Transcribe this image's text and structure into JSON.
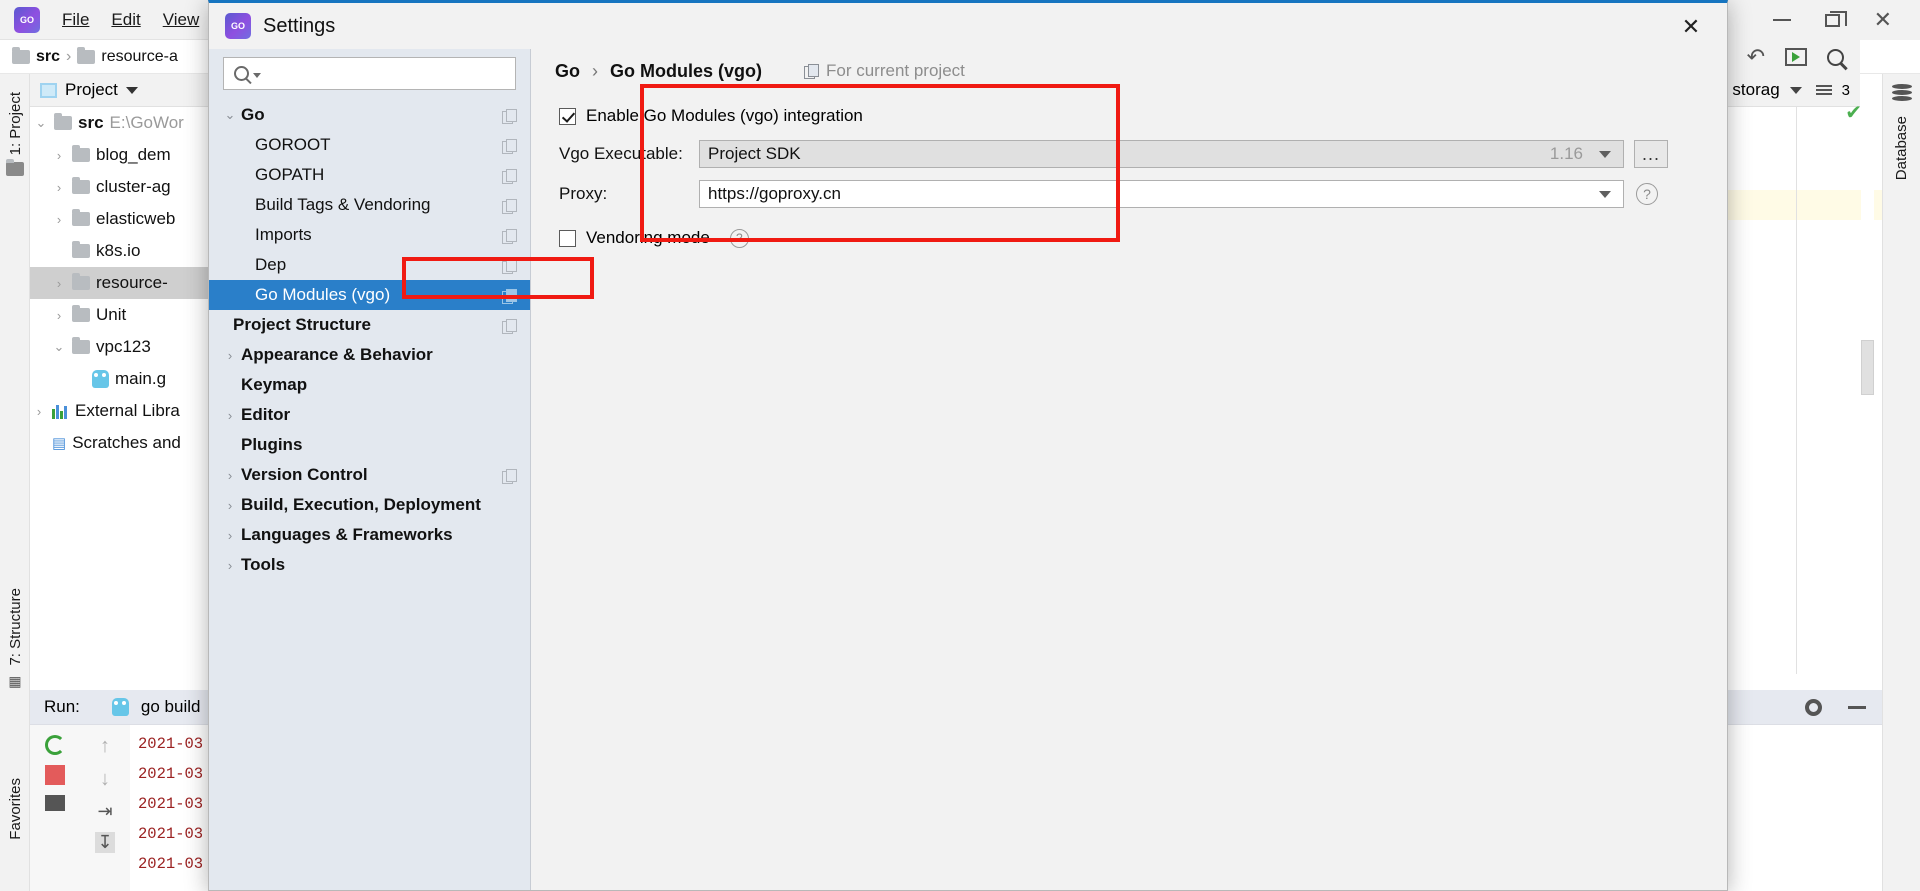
{
  "ide": {
    "menu": [
      "File",
      "Edit",
      "View"
    ],
    "breadcrumb": [
      "src",
      "resource-a"
    ],
    "project_tool_label": "Project",
    "left_strips": {
      "project": "1: Project",
      "structure": "7: Structure",
      "favorites": "Favorites"
    },
    "tree": [
      {
        "label": "src",
        "suffix": "E:\\GoWor",
        "chev": "v",
        "bold": true,
        "indent": 0,
        "icon": "folder-icon"
      },
      {
        "label": "blog_dem",
        "suffix": "",
        "chev": ">",
        "bold": false,
        "indent": 1,
        "icon": "folder-icon"
      },
      {
        "label": "cluster-ag",
        "suffix": "",
        "chev": ">",
        "bold": false,
        "indent": 1,
        "icon": "folder-icon"
      },
      {
        "label": "elasticweb",
        "suffix": "",
        "chev": ">",
        "bold": false,
        "indent": 1,
        "icon": "folder-icon"
      },
      {
        "label": "k8s.io",
        "suffix": "",
        "chev": "",
        "bold": false,
        "indent": 1,
        "icon": "folder-icon"
      },
      {
        "label": "resource-",
        "suffix": "",
        "chev": ">",
        "bold": false,
        "indent": 1,
        "icon": "folder-icon",
        "selected": true
      },
      {
        "label": "Unit",
        "suffix": "",
        "chev": ">",
        "bold": false,
        "indent": 1,
        "icon": "folder-icon"
      },
      {
        "label": "vpc123",
        "suffix": "",
        "chev": "v",
        "bold": false,
        "indent": 1,
        "icon": "folder-icon"
      },
      {
        "label": "main.g",
        "suffix": "",
        "chev": "",
        "bold": false,
        "indent": 2,
        "icon": "go-file-icon"
      },
      {
        "label": "External Libra",
        "suffix": "",
        "chev": ">",
        "bold": false,
        "indent": 0,
        "icon": "libraries-icon"
      },
      {
        "label": "Scratches and",
        "suffix": "",
        "chev": "",
        "bold": false,
        "indent": 0,
        "icon": "scratches-icon"
      }
    ],
    "editor_tab": {
      "label": "storag",
      "badge": "3"
    },
    "right_strip_label": "Database",
    "run_panel": {
      "title": "Run:",
      "config": "go build",
      "log_lines": [
        "2021-03",
        "2021-03",
        "2021-03",
        "2021-03",
        "2021-03"
      ]
    }
  },
  "dialog": {
    "title": "Settings",
    "close_label": "✕",
    "search": {
      "value": "",
      "placeholder": ""
    },
    "tree": [
      {
        "label": "Go",
        "bold": true,
        "chev": "v",
        "indent": 0,
        "copy": true
      },
      {
        "label": "GOROOT",
        "bold": false,
        "chev": "",
        "indent": 1,
        "copy": true
      },
      {
        "label": "GOPATH",
        "bold": false,
        "chev": "",
        "indent": 1,
        "copy": true
      },
      {
        "label": "Build Tags & Vendoring",
        "bold": false,
        "chev": "",
        "indent": 1,
        "copy": true
      },
      {
        "label": "Imports",
        "bold": false,
        "chev": "",
        "indent": 1,
        "copy": true
      },
      {
        "label": "Dep",
        "bold": false,
        "chev": "",
        "indent": 1,
        "copy": true
      },
      {
        "label": "Go Modules (vgo)",
        "bold": false,
        "chev": "",
        "indent": 1,
        "copy": true,
        "selected": true
      },
      {
        "label": "Project Structure",
        "bold": true,
        "chev": "",
        "indent": 0,
        "copy": true
      },
      {
        "label": "Appearance & Behavior",
        "bold": true,
        "chev": ">",
        "indent": 0,
        "copy": false
      },
      {
        "label": "Keymap",
        "bold": true,
        "chev": "",
        "indent": 0,
        "copy": false
      },
      {
        "label": "Editor",
        "bold": true,
        "chev": ">",
        "indent": 0,
        "copy": false
      },
      {
        "label": "Plugins",
        "bold": true,
        "chev": "",
        "indent": 0,
        "copy": false
      },
      {
        "label": "Version Control",
        "bold": true,
        "chev": ">",
        "indent": 0,
        "copy": true
      },
      {
        "label": "Build, Execution, Deployment",
        "bold": true,
        "chev": ">",
        "indent": 0,
        "copy": false
      },
      {
        "label": "Languages & Frameworks",
        "bold": true,
        "chev": ">",
        "indent": 0,
        "copy": false
      },
      {
        "label": "Tools",
        "bold": true,
        "chev": ">",
        "indent": 0,
        "copy": false
      }
    ],
    "breadcrumb": {
      "root": "Go",
      "separator": "›",
      "leaf": "Go Modules (vgo)",
      "scope_note": "For current project"
    },
    "settings": {
      "enable_modules": {
        "label": "Enable Go Modules (vgo) integration",
        "checked": true
      },
      "vgo_executable": {
        "label": "Vgo Executable:",
        "value": "Project SDK",
        "version": "1.16",
        "browse_label": "..."
      },
      "proxy": {
        "label": "Proxy:",
        "value": "https://goproxy.cn"
      },
      "vendoring": {
        "label": "Vendoring mode",
        "checked": false,
        "help": "?"
      }
    },
    "highlight_color": "#f01a12",
    "accent_color": "#2a7fc9"
  }
}
